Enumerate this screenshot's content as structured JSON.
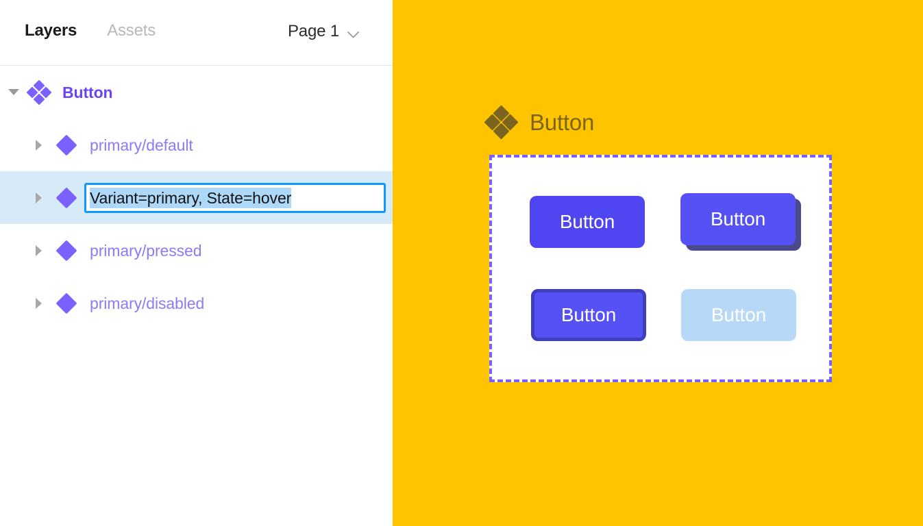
{
  "panel": {
    "tabs": [
      {
        "label": "Layers",
        "active": true
      },
      {
        "label": "Assets",
        "active": false
      }
    ],
    "page_selector": {
      "label": "Page 1",
      "icon": "chevron-down-icon"
    }
  },
  "layers": [
    {
      "id": "root",
      "label": "Button",
      "icon": "component-set-icon",
      "caret": "caret-down",
      "depth": 0,
      "editing": false,
      "selected": false
    },
    {
      "id": "primary-default",
      "label": "primary/default",
      "icon": "component-icon",
      "caret": "caret-right",
      "depth": 1,
      "editing": false,
      "selected": false
    },
    {
      "id": "primary-hover",
      "label": "Variant=primary, State=hover",
      "icon": "component-icon",
      "caret": "caret-right",
      "depth": 1,
      "editing": true,
      "selected": true
    },
    {
      "id": "primary-pressed",
      "label": "primary/pressed",
      "icon": "component-icon",
      "caret": "caret-right",
      "depth": 1,
      "editing": false,
      "selected": false
    },
    {
      "id": "primary-disabled",
      "label": "primary/disabled",
      "icon": "component-icon",
      "caret": "caret-right",
      "depth": 1,
      "editing": false,
      "selected": false
    }
  ],
  "canvas": {
    "background_color": "#ffc400",
    "component_set": {
      "title": "Button",
      "title_color": "#7a6420",
      "icon": "component-set-icon",
      "border_style": "dashed",
      "border_color": "#7b61ff"
    },
    "variants": [
      {
        "id": "default",
        "label": "Button",
        "state": "default",
        "bg": "#4f46f2",
        "text_color": "#ffffff"
      },
      {
        "id": "hover",
        "label": "Button",
        "state": "hover",
        "bg": "#5551f5",
        "text_color": "#ffffff",
        "shadow": "#4a4a8c"
      },
      {
        "id": "pressed",
        "label": "Button",
        "state": "pressed",
        "bg": "#5551f5",
        "text_color": "#ffffff",
        "border": "#3f3fbd"
      },
      {
        "id": "disabled",
        "label": "Button",
        "state": "disabled",
        "bg": "#b8d8f8",
        "text_color": "#ffffff"
      }
    ]
  },
  "colors": {
    "accent_purple": "#7b61ff",
    "selection_blue": "#0d99ff",
    "row_highlight": "#d6eaf8",
    "text_selection": "#aed8f7",
    "canvas_yellow": "#ffc400"
  }
}
